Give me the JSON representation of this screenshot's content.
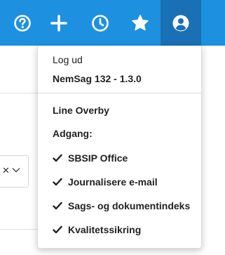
{
  "toolbar": {
    "icons": [
      "help-icon",
      "plus-icon",
      "clock-icon",
      "star-icon",
      "user-icon"
    ],
    "colors": {
      "bar": "#1e90e0",
      "active": "#1a70b4",
      "icon": "#ffffff"
    }
  },
  "background": {
    "select_clear": "✕"
  },
  "user_menu": {
    "logout": "Log ud",
    "version": "NemSag 132 - 1.3.0",
    "user_name": "Line Overby",
    "access_heading": "Adgang:",
    "access_items": [
      "SBSIP Office",
      "Journalisere e-mail",
      "Sags- og dokumentindeks",
      "Kvalitetssikring"
    ]
  }
}
